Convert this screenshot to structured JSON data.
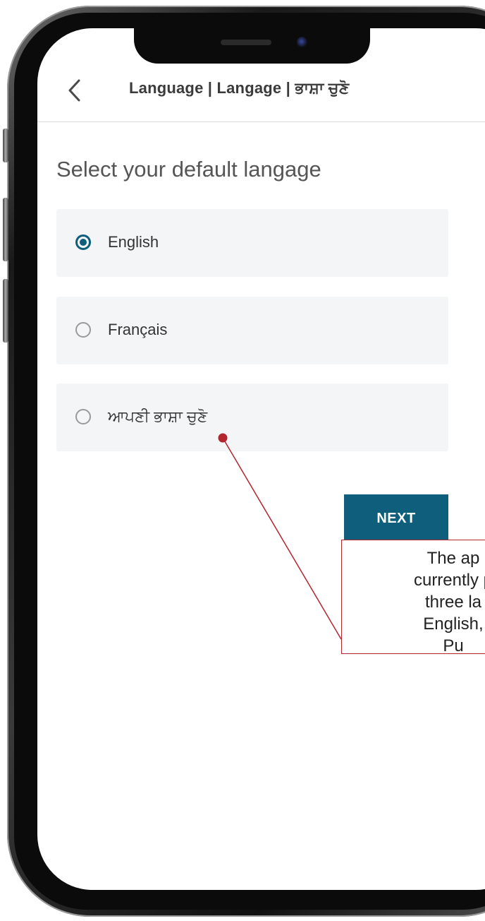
{
  "header": {
    "back_icon": "chevron-left-icon",
    "title": "Language | Langage | ਭਾਸ਼ਾ ਚੁਣੋ"
  },
  "page": {
    "title": "Select your default langage"
  },
  "languages": [
    {
      "label": "English",
      "selected": true
    },
    {
      "label": "Français",
      "selected": false
    },
    {
      "label": "ਆਪਣੀ ਭਾਸ਼ਾ ਚੁਣੋ",
      "selected": false
    }
  ],
  "actions": {
    "next_label": "NEXT"
  },
  "annotation": {
    "text": "The ap\ncurrently p\nthree la\nEnglish,\nPu"
  },
  "colors": {
    "accent": "#0f5f7c",
    "option_background": "#f4f5f6",
    "annotation_border": "#b3262f"
  }
}
